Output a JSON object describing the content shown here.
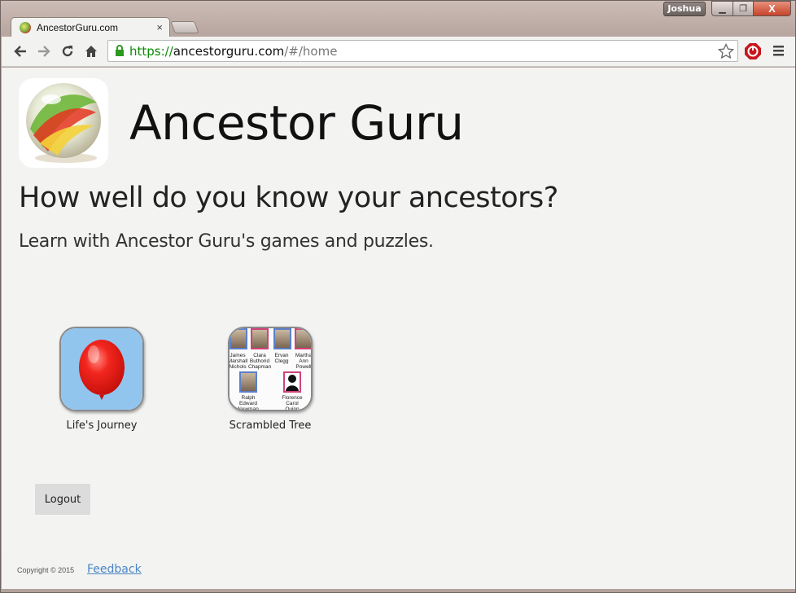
{
  "window": {
    "user": "Joshua",
    "min_symbol": "▁",
    "max_symbol": "❐",
    "close_symbol": "X"
  },
  "tab": {
    "title": "AncestorGuru.com",
    "close": "×"
  },
  "toolbar": {
    "url_scheme": "https://",
    "url_host": "ancestorguru.com",
    "url_path": "/#/home"
  },
  "page": {
    "site_title": "Ancestor Guru",
    "headline": "How well do you know your ancestors?",
    "subline": "Learn with Ancestor Guru's games and puzzles.",
    "games": [
      {
        "label": "Life's Journey",
        "icon": "balloon-icon"
      },
      {
        "label": "Scrambled Tree",
        "icon": "family-tree-icon",
        "people": [
          "James Marshall Nichols",
          "Clara Buthorid Chapman",
          "Ervan Clegg",
          "Martha Ann Powell",
          "Ralph Edward Newman",
          "Florence Carol Quinn"
        ]
      }
    ],
    "logout_label": "Logout",
    "copyright": "Copyright © 2015",
    "feedback_label": "Feedback"
  },
  "colors": {
    "page_bg": "#f3f3f2",
    "link": "#4a86c5",
    "secure_green": "#0b8a00",
    "balloon_red": "#e8231f",
    "balloon_bg": "#92c5ee"
  }
}
